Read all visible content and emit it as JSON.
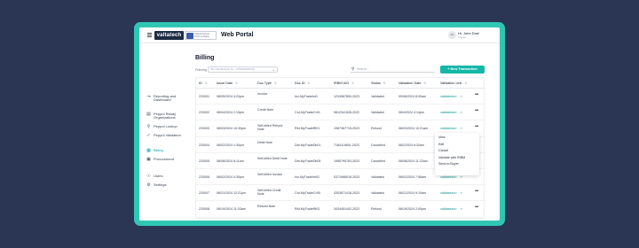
{
  "topbar": {
    "logo_text": "valtatech",
    "cert_text": "Peppol Access Point Certified",
    "portal_title": "Web Portal",
    "user_initials": "JD",
    "user_name": "Hi, John Doe!",
    "user_sub": "Logout"
  },
  "sidebar": {
    "items": [
      {
        "label": "Reporting and Dashboard",
        "icon": "chart-icon"
      },
      {
        "label": "Peppol Ready Organizations",
        "icon": "document-icon"
      },
      {
        "label": "Peppol Lookup",
        "icon": "search-icon"
      },
      {
        "label": "Peppol Validation",
        "icon": "check-circle-icon"
      },
      {
        "label": "Billing",
        "icon": "receipt-icon"
      },
      {
        "label": "Procurement",
        "icon": "cart-icon"
      },
      {
        "label": "Users",
        "icon": "users-icon"
      },
      {
        "label": "Settings",
        "icon": "gear-icon"
      }
    ],
    "active": "Billing"
  },
  "main": {
    "title": "Billing",
    "filter_label": "Filtering",
    "filter_value": "Tax identification No. (ON000000001)",
    "search_placeholder": "Search...",
    "new_button": "+ New Transaction"
  },
  "table": {
    "columns": [
      "ID",
      "Issue Date",
      "Doc Type",
      "Doc ID",
      "IRBM UID",
      "Status",
      "Validation Date",
      "Validation Link"
    ],
    "rows": [
      {
        "id": "220001",
        "date": "08/05/2024 4:20pm",
        "type": "Invoice",
        "doc": "Inv-MyTradeInt1",
        "uid": "1234567890-2023",
        "status": "Validated",
        "vdate": "09/06/2024 8:00am",
        "link": "validateduri"
      },
      {
        "id": "220002",
        "date": "08/04/2024 2:15pm",
        "type": "Credit Note",
        "doc": "Crd-MyTradeCr01",
        "uid": "9812341526-2022",
        "status": "Validated",
        "vdate": "08/4/2024 4:14pm",
        "link": "validateduri"
      },
      {
        "id": "220003",
        "date": "08/03/2024 10:30pm",
        "type": "Self-billed Refund Note",
        "doc": "Rfd-MyTradeRf01",
        "uid": "1987367715-2023",
        "status": "Refund",
        "vdate": "08/03/2024 10:21am",
        "link": "validateduri"
      },
      {
        "id": "220004",
        "date": "08/02/2024 1:30pm",
        "type": "Debit Note",
        "doc": "Dbt-MyTradeDb01",
        "uid": "7184118801-2023",
        "status": "Cancelled",
        "vdate": "08/2/2024 6:32am",
        "link": "validateduri"
      },
      {
        "id": "220005",
        "date": "08/08/2024 8:11am",
        "type": "Self-billed Debit Note",
        "doc": "Dbt-MyTradeDb05",
        "uid": "1985790763-2023",
        "status": "Cancelled",
        "vdate": "08/08/2024 11:22am",
        "link": "validateduri"
      },
      {
        "id": "220006",
        "date": "08/02/2024 4:30pm",
        "type": "Self-billed Invoice",
        "doc": "Inv-MyTradeInt02",
        "uid": "0371968018-2023",
        "status": "Validated",
        "vdate": "08/02/2024 7:58am",
        "link": "validateduri"
      },
      {
        "id": "220007",
        "date": "08/21/2024 12:21pm",
        "type": "Self-billed Credit Note",
        "doc": "Crd-MyTradeCr05",
        "uid": "4353671418-2023",
        "status": "Validated",
        "vdate": "08/21/2024 9:10am",
        "link": "validateduri"
      },
      {
        "id": "220008",
        "date": "08/19/2024 11:03am",
        "type": "Refund Note",
        "doc": "Rfd-MyTradeRf02",
        "uid": "3434451442-2023",
        "status": "Refund",
        "vdate": "08/19/2024 2:00pm",
        "link": "validateduri"
      }
    ]
  },
  "context_menu": {
    "items": [
      "View",
      "Edit",
      "Cancel",
      "Validate with IRBM",
      "Send to Buyer"
    ]
  }
}
